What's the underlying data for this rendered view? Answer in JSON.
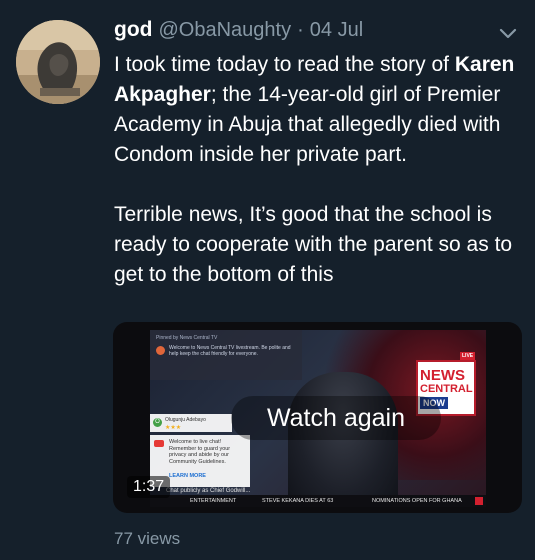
{
  "tweet": {
    "display_name": "god",
    "handle": "@ObaNaughty",
    "separator": "·",
    "date": "04 Jul",
    "paragraph1_a": "I took time today to read the story of ",
    "paragraph1_bold": "Karen Akpagher",
    "paragraph1_b": "; the 14-year-old girl of Premier Academy in Abuja that allegedly died with Condom inside her private part.",
    "paragraph2": "Terrible news, It’s good that the school is ready to cooperate with the parent so as to get to the bottom of this",
    "views": "77 views"
  },
  "video": {
    "watch_again_label": "Watch again",
    "duration": "1:37",
    "chat_header": "Pinned by News Central TV",
    "chat_pinned_msg": "Welcome to News Central TV livestream. Be polite and help keep the chat friendly for everyone.",
    "chat_user": "Olugunju Adebayo",
    "chat_stars": "★★★",
    "welcome_text": "Welcome to live chat! Remember to guard your privacy and abide by our Community Guidelines.",
    "learn_more": "LEARN MORE",
    "chat_input_placeholder": "Chat publicly as Chief Godwill...",
    "logo_line1": "NEWS",
    "logo_line2": "CENTRAL",
    "logo_line3": "NOW",
    "live_badge": "LIVE",
    "ticker_1": "ENTERTAINMENT",
    "ticker_2": "STEVE KEKANA DIES AT 63",
    "ticker_3": "NOMINATIONS OPEN FOR GHANA"
  },
  "colors": {
    "background": "#15202b",
    "secondary_text": "#8899a6",
    "brand_red": "#d3202f"
  },
  "icons": {
    "more": "chevron-down-icon",
    "avatar": "statue-avatar",
    "youtube": "youtube-icon"
  }
}
